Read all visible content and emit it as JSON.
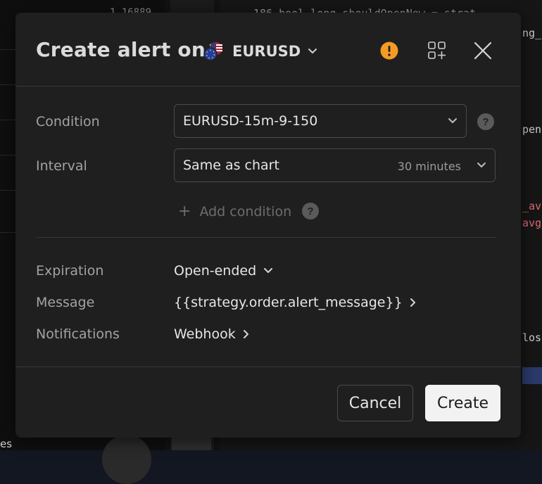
{
  "background": {
    "left_number": "1.16889",
    "code_lines": [
      {
        "text": "186   bool long_shouldOpenNew = strat",
        "color": "#9a9a9a"
      },
      {
        "text": "ng_",
        "color": "#d0d0d0"
      },
      {
        "text": "pen",
        "color": "#d0d0d0"
      },
      {
        "text": "_av",
        "color": "#e06c75"
      },
      {
        "text": "avg",
        "color": "#e06c75"
      },
      {
        "text": "los",
        "color": "#d0d0d0"
      }
    ],
    "left_text": "es"
  },
  "dialog": {
    "title": "Create alert on",
    "symbol": "EURUSD",
    "condition": {
      "label": "Condition",
      "value": "EURUSD-15m-9-150"
    },
    "interval": {
      "label": "Interval",
      "value": "Same as chart",
      "sub": "30 minutes"
    },
    "add_condition": "Add condition",
    "expiration": {
      "label": "Expiration",
      "value": "Open-ended"
    },
    "message": {
      "label": "Message",
      "value": "{{strategy.order.alert_message}}"
    },
    "notifications": {
      "label": "Notifications",
      "value": "Webhook"
    },
    "buttons": {
      "cancel": "Cancel",
      "create": "Create"
    }
  },
  "icons": {
    "warning": "warning-icon",
    "add_chart": "add-chart-icon",
    "close": "close-icon",
    "help": "question-icon"
  },
  "colors": {
    "warning": "#f59a23",
    "dialog_bg": "#1f1f1f",
    "primary_button_bg": "#f2f2f2"
  }
}
